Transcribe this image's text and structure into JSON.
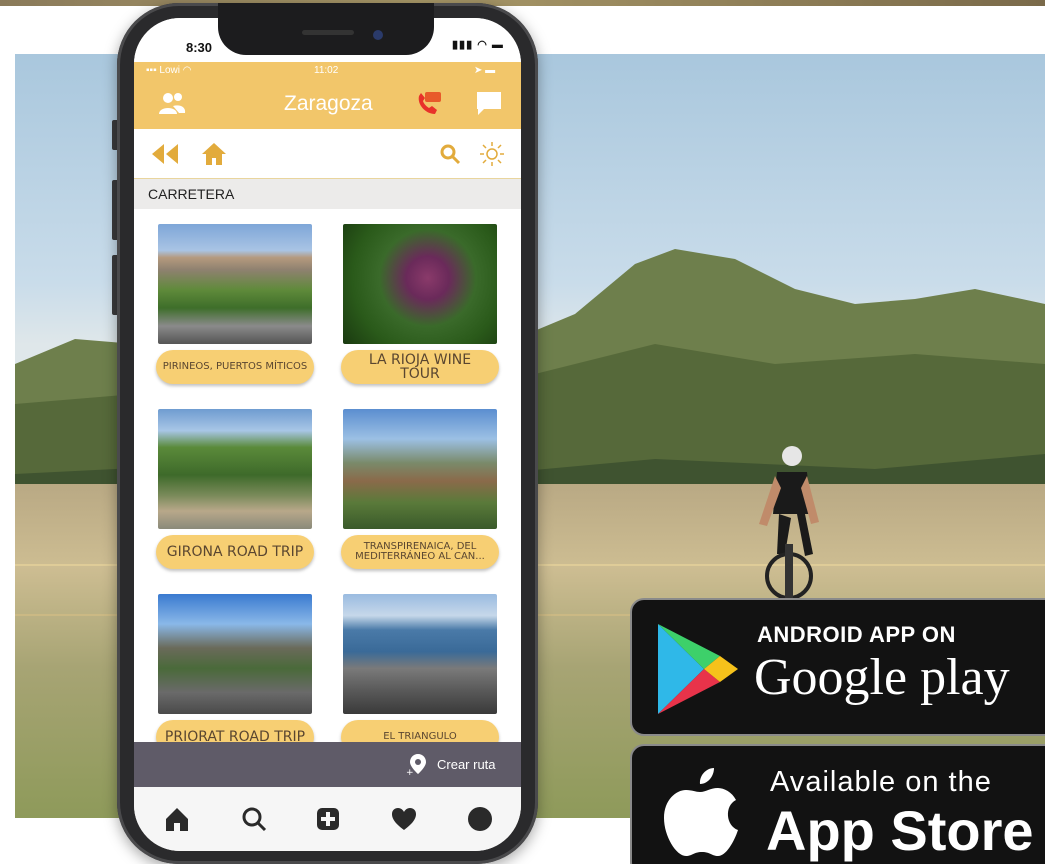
{
  "phone": {
    "status_time": "8:30",
    "inner_carrier": "Lowi",
    "inner_time": "11:02",
    "header_title": "Zaragoza",
    "section_title": "CARRETERA",
    "create_route_label": "Crear ruta",
    "cards": [
      {
        "label": "PIRINEOS, PUERTOS MÍTICOS",
        "size": "small"
      },
      {
        "label": "LA RIOJA WINE TOUR",
        "size": "big"
      },
      {
        "label": "GIRONA ROAD TRIP",
        "size": "big"
      },
      {
        "label": "TRANSPIRENAICA, DEL MEDITERRÁNEO AL CAN...",
        "size": "small"
      },
      {
        "label": "PRIORAT ROAD TRIP",
        "size": "big"
      },
      {
        "label": "EL TRIANGULO",
        "size": "small"
      }
    ]
  },
  "badges": {
    "google_play_small": "ANDROID APP ON",
    "google_play_big": "Google play",
    "app_store_small": "Available on the",
    "app_store_big": "App Store"
  },
  "colors": {
    "header_yellow": "#f2c66a",
    "card_label_yellow": "#f7cf73",
    "route_bar": "#5f5b68",
    "badge_black": "#121212"
  }
}
